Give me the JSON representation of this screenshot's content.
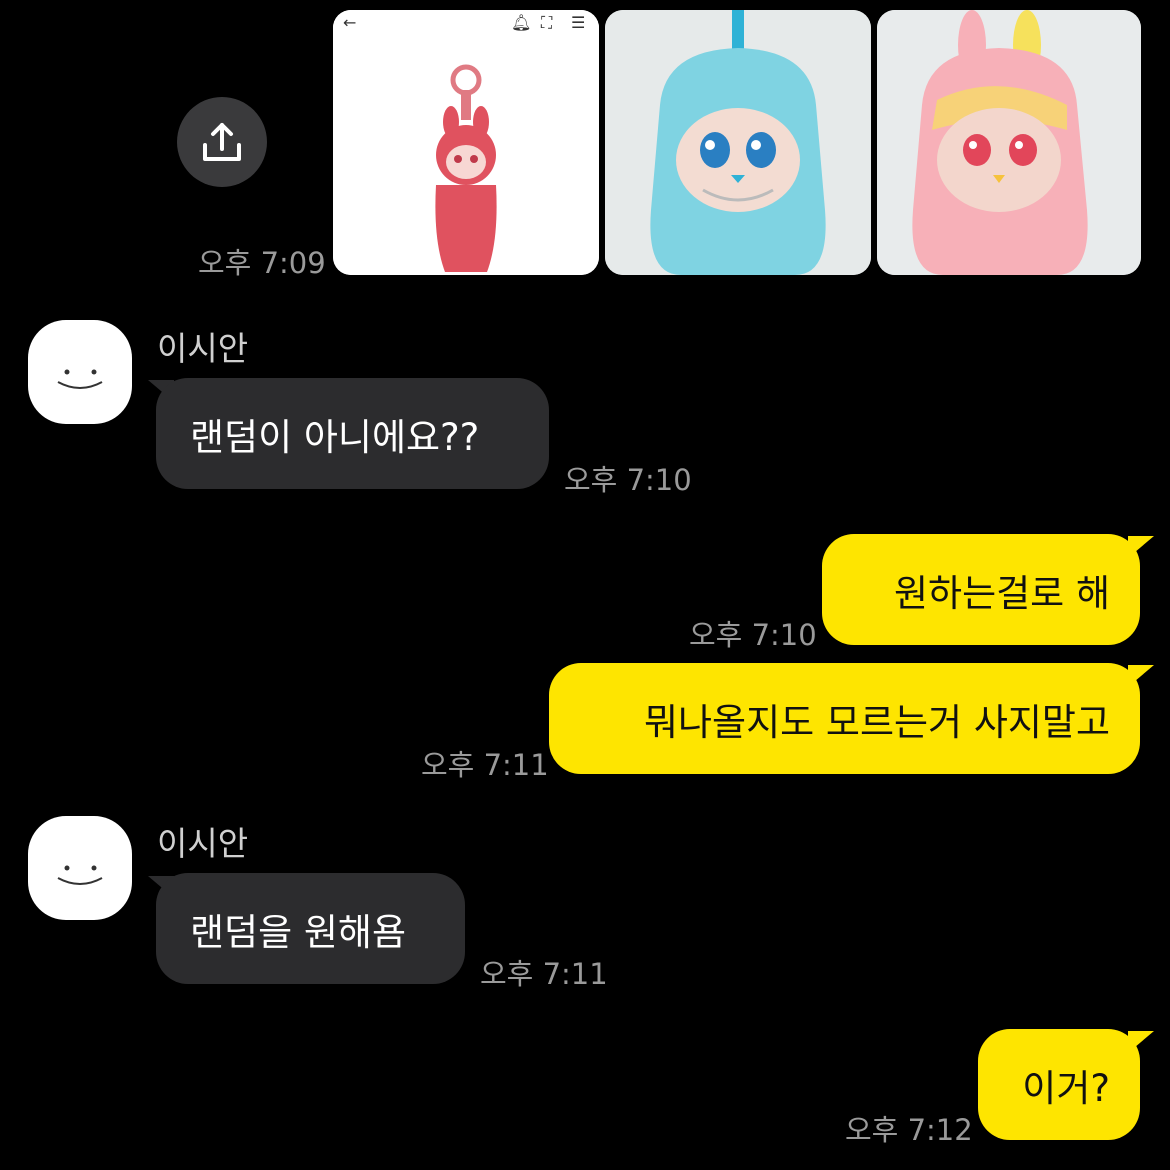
{
  "images_message": {
    "time": "오후 7:09",
    "images": [
      {
        "name": "labubu-red-keychain",
        "colors": {
          "body": "#e0525f",
          "face": "#f7d7d3",
          "ring": "#e07a83"
        }
      },
      {
        "name": "labubu-blue",
        "colors": {
          "body": "#7fd3e2",
          "face": "#f3dcd2",
          "strap": "#2fb2d6"
        }
      },
      {
        "name": "labubu-rainbow",
        "colors": {
          "body": "#f7b0b8",
          "face": "#f3d6cc",
          "highlight": "#f6e15c"
        }
      }
    ]
  },
  "messages": [
    {
      "direction": "in",
      "sender": "이시안",
      "text": "랜덤이 아니에요??",
      "time": "오후 7:10"
    },
    {
      "direction": "out",
      "text": "원하는걸로 해",
      "time": "오후 7:10"
    },
    {
      "direction": "out",
      "text": "뭐나올지도 모르는거 사지말고",
      "time": "오후 7:11"
    },
    {
      "direction": "in",
      "sender": "이시안",
      "text": "랜덤을 원해욤",
      "time": "오후 7:11"
    },
    {
      "direction": "out",
      "text": "이거?",
      "time": "오후 7:12"
    }
  ],
  "colors": {
    "background": "#000000",
    "incoming_bubble": "#2c2c2e",
    "outgoing_bubble": "#fee500",
    "timestamp": "#9a9a9a"
  },
  "icons": {
    "share": "share-upload-icon",
    "avatar": "smiley-avatar"
  }
}
